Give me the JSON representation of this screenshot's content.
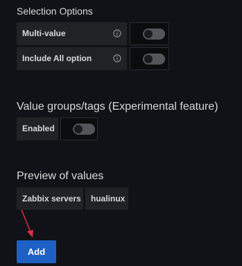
{
  "selection_options": {
    "title": "Selection Options",
    "multi_value_label": "Multi-value",
    "include_all_label": "Include All option"
  },
  "value_groups": {
    "title": "Value groups/tags (Experimental feature)",
    "enabled_label": "Enabled"
  },
  "preview": {
    "title": "Preview of values",
    "values": [
      "Zabbix servers",
      "hualinux"
    ]
  },
  "add_button_label": "Add",
  "colors": {
    "background": "#111217",
    "primary_button": "#1f60c4",
    "annotation_arrow": "#e02f44"
  },
  "icons": [
    "info-icon",
    "annotation-arrow-icon"
  ]
}
